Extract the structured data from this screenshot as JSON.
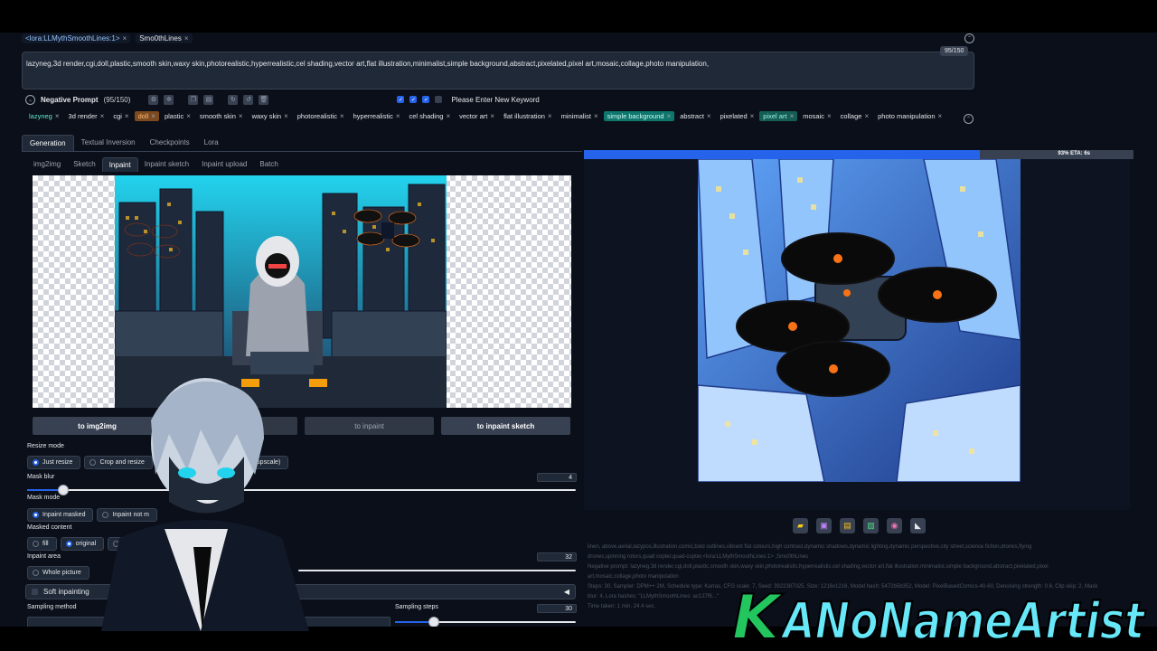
{
  "positive_chips": [
    "<lora:LLMythSmoothLines:1>",
    "Smo0thLines"
  ],
  "positive_prompt": "lazyneg,3d render,cgi,doll,plastic,smooth skin,waxy skin,photorealistic,hyperrealistic,cel shading,vector art,flat illustration,minimalist,simple background,abstract,pixelated,pixel art,mosaic,collage,photo manipulation,",
  "token_counter": "95/150",
  "negative": {
    "title": "Negative Prompt",
    "count": "(95/150)",
    "keyword_placeholder": "Please Enter New Keyword"
  },
  "negative_tags": [
    {
      "label": "lazyneg",
      "style": "lazy"
    },
    {
      "label": "3d render",
      "style": ""
    },
    {
      "label": "cgi",
      "style": ""
    },
    {
      "label": "doll",
      "style": "orange"
    },
    {
      "label": "plastic",
      "style": ""
    },
    {
      "label": "smooth skin",
      "style": ""
    },
    {
      "label": "waxy skin",
      "style": ""
    },
    {
      "label": "photorealistic",
      "style": ""
    },
    {
      "label": "hyperrealistic",
      "style": ""
    },
    {
      "label": "cel shading",
      "style": ""
    },
    {
      "label": "vector art",
      "style": ""
    },
    {
      "label": "flat illustration",
      "style": ""
    },
    {
      "label": "minimalist",
      "style": ""
    },
    {
      "label": "simple background",
      "style": "teal"
    },
    {
      "label": "abstract",
      "style": ""
    },
    {
      "label": "pixelated",
      "style": ""
    },
    {
      "label": "pixel art",
      "style": "teal2"
    },
    {
      "label": "mosaic",
      "style": ""
    },
    {
      "label": "collage",
      "style": ""
    },
    {
      "label": "photo manipulation",
      "style": ""
    }
  ],
  "main_tabs": [
    "Generation",
    "Textual Inversion",
    "Checkpoints",
    "Lora"
  ],
  "sub_tabs": [
    "img2img",
    "Sketch",
    "Inpaint",
    "Inpaint sketch",
    "Inpaint upload",
    "Batch"
  ],
  "send_buttons": [
    "to img2img",
    "to inpaint",
    "to inpaint sketch"
  ],
  "resize_mode": {
    "label": "Resize mode",
    "options": [
      "Just resize",
      "Crop and resize"
    ],
    "partial_option": "nt upscale)"
  },
  "mask_blur": {
    "label": "Mask blur",
    "value": "4",
    "fraction": 0.065
  },
  "mask_mode": {
    "label": "Mask mode",
    "options": [
      "Inpaint masked",
      "Inpaint not m"
    ]
  },
  "masked_content": {
    "label": "Masked content",
    "options": [
      "fill",
      "original",
      "la"
    ]
  },
  "inpaint_area": {
    "label": "Inpaint area",
    "options": [
      "Whole picture"
    ],
    "padding_value": "32",
    "padding_fraction": 0.12
  },
  "soft_inpainting": {
    "label": "Soft inpainting"
  },
  "sampling_method": {
    "label": "Sampling method"
  },
  "sampling_steps": {
    "label": "Sampling steps",
    "value": "30",
    "fraction": 0.21
  },
  "progress": {
    "text": "93% ETA: 6s",
    "fraction": 0.72
  },
  "gallery_icons": [
    "folder-icon",
    "save-icon",
    "zip-icon",
    "image-icon",
    "palette-icon",
    "ruler-icon"
  ],
  "info_lines": [
    "linen, above,aerial,lazypos,illustration,comic,bold outlines,vibrant flat colours,high contrast,dynamic shadows,dynamic lighting,dynamic perspective,city street,science fiction,drones,flying",
    "drones,spinning rotors,quad copter,quad-copter,<lora:LLMythSmoothLines:1> ,Smo0thLines",
    "Negative prompt: lazyneg,3d render,cgi,doll,plastic,smooth skin,waxy skin,photorealistic,hyperrealistic,cel shading,vector art,flat illustration,minimalist,simple background,abstract,pixelated,pixel",
    "art,mosaic,collage,photo manipulation",
    "Steps: 30, Sampler: DPM++ 2M, Schedule type: Karras, CFG scale: 7, Seed: 3922387025, Size: 1216x1216, Model hash: 5472b5b352, Model: PixelBasedComics-40-60, Denoising strength: 0.6, Clip skip: 2, Mask",
    "blur: 4, Lora hashes: \"LLMythSmoothLines: ac127f6...\"",
    "Time taken: 1 min. 24.4 sec."
  ],
  "watermark_text": "ANoNameArtist",
  "watermark_logo_letter": "K"
}
